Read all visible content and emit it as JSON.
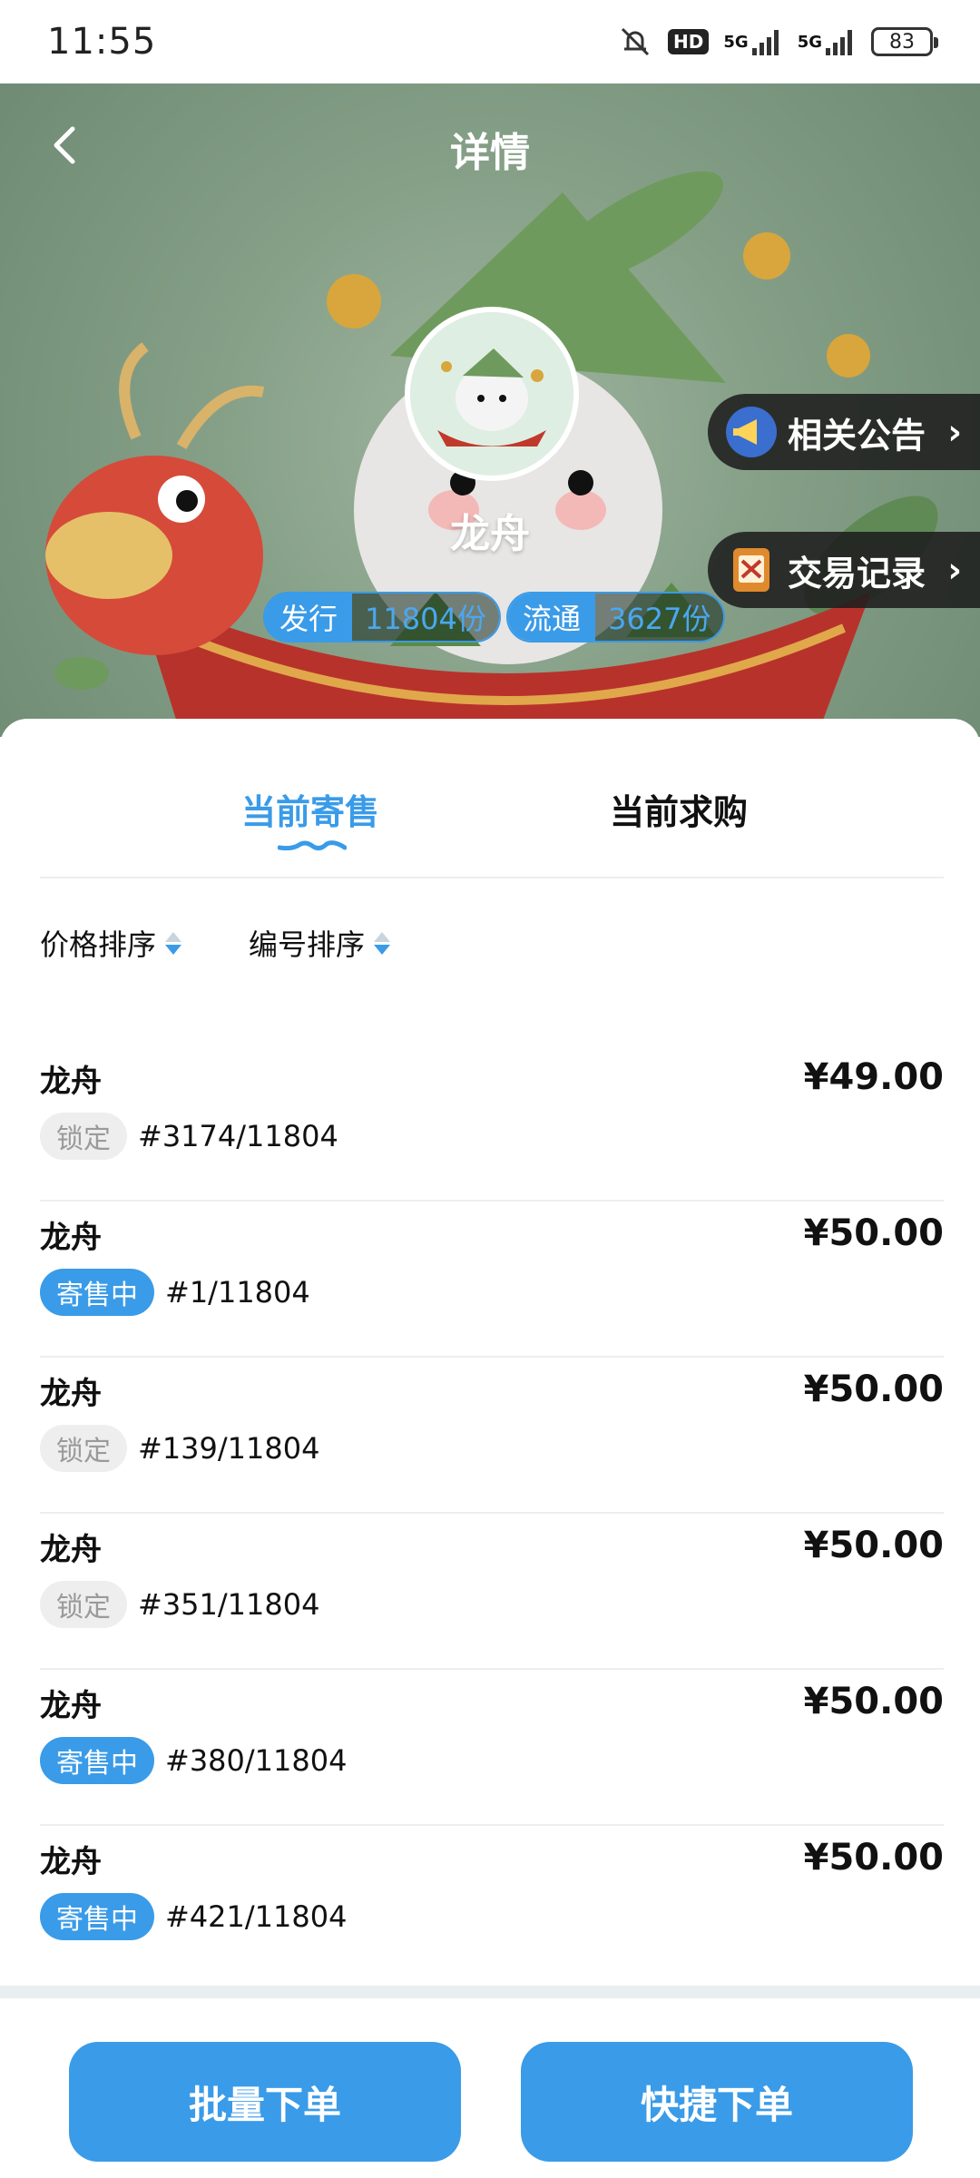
{
  "status_bar": {
    "time": "11:55",
    "hd_label": "HD",
    "network_1": "5G",
    "network_2": "5G",
    "battery": "83",
    "icons": [
      "mute-icon",
      "hd-icon",
      "signal-icon",
      "signal-icon",
      "battery-icon"
    ]
  },
  "header": {
    "title": "详情",
    "back_icon": "chevron-left-icon"
  },
  "item": {
    "name": "龙舟",
    "side_links": [
      {
        "label": "相关公告",
        "icon": "megaphone-icon"
      },
      {
        "label": "交易记录",
        "icon": "book-icon"
      }
    ],
    "stats": [
      {
        "label": "发行",
        "value": "11804份"
      },
      {
        "label": "流通",
        "value": "3627份"
      }
    ]
  },
  "tabs": {
    "items": [
      "当前寄售",
      "当前求购"
    ],
    "active_index": 0
  },
  "sorts": [
    "价格排序",
    "编号排序"
  ],
  "listings": [
    {
      "name": "龙舟",
      "status": "锁定",
      "status_type": "locked",
      "serial": "#3174/11804",
      "price": "¥49.00"
    },
    {
      "name": "龙舟",
      "status": "寄售中",
      "status_type": "selling",
      "serial": "#1/11804",
      "price": "¥50.00"
    },
    {
      "name": "龙舟",
      "status": "锁定",
      "status_type": "locked",
      "serial": "#139/11804",
      "price": "¥50.00"
    },
    {
      "name": "龙舟",
      "status": "锁定",
      "status_type": "locked",
      "serial": "#351/11804",
      "price": "¥50.00"
    },
    {
      "name": "龙舟",
      "status": "寄售中",
      "status_type": "selling",
      "serial": "#380/11804",
      "price": "¥50.00"
    },
    {
      "name": "龙舟",
      "status": "寄售中",
      "status_type": "selling",
      "serial": "#421/11804",
      "price": "¥50.00"
    }
  ],
  "bottom_bar": {
    "batch_order": "批量下单",
    "quick_order": "快捷下单"
  },
  "colors": {
    "accent": "#3a9be8",
    "locked_bg": "#eeeeee",
    "hero_bg": "#86a088"
  }
}
